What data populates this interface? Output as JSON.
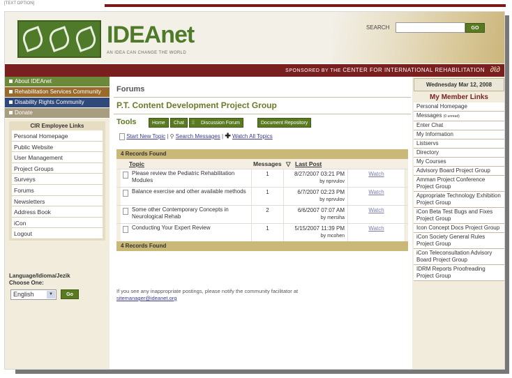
{
  "text_option": "[TEXT OPTION]",
  "header": {
    "logo_text": "IDEAnet",
    "tagline": "AN IDEA CAN CHANGE THE WORLD",
    "search_label": "SEARCH",
    "search_value": "",
    "search_go": "GO"
  },
  "sponsor": {
    "prefix": "SPONSORED BY THE ",
    "link": "CENTER FOR INTERNATIONAL REHABILITATION"
  },
  "leftnav": {
    "items": [
      {
        "label": "About IDEAnet"
      },
      {
        "label": "Rehabilitation Services Community"
      },
      {
        "label": "Disability Rights Community"
      },
      {
        "label": "Donate"
      }
    ],
    "cir_title": "CIR Employee Links",
    "cir_links": [
      "Personal Homepage",
      "Public Website",
      "User Management",
      "Project Groups",
      "Surveys",
      "Forums",
      "Newsletters",
      "Address Book",
      "iCon",
      "Logout"
    ],
    "language_label": "Language/Idioma/Jezik",
    "choose_one": "Choose One:",
    "language_value": "English",
    "language_go": "Go"
  },
  "main": {
    "heading": "Forums",
    "group_title": "P.T. Content Development Project Group",
    "tools_label": "Tools",
    "tools": [
      "Home",
      "Chat",
      "Discussion Forum",
      "Document Repository"
    ],
    "actions": {
      "start_new_topic": "Start New Topic",
      "search_messages": "Search Messages",
      "watch_all": "Watch All Topics"
    },
    "records_header": "4 Records Found",
    "records_footer": "4 Records Found",
    "columns": {
      "topic": "Topic",
      "messages": "Messages",
      "last_post": "Last Post"
    },
    "rows": [
      {
        "topic": "Please review the Pediatric Rehabilitation Modules",
        "messages": "1",
        "date": "8/27/2007 03:21 PM",
        "by": "by nprvulov",
        "watch": "Watch"
      },
      {
        "topic": "Balance exercise and other available methods",
        "messages": "1",
        "date": "6/7/2007 02:23 PM",
        "by": "by nprvulov",
        "watch": "Watch"
      },
      {
        "topic": "Some other Contemporary Concepts in Neurological Rehab",
        "messages": "2",
        "date": "6/6/2007 07:07 AM",
        "by": "by mersiha",
        "watch": "Watch"
      },
      {
        "topic": "Conducting Your Expert Review",
        "messages": "1",
        "date": "5/15/2007 11:39 PM",
        "by": "by mcohen",
        "watch": "Watch"
      }
    ],
    "notice_text": "If you see any inappropriate postings, please notify the community facilitator at",
    "notice_email": "sitemanager@ideanet.org"
  },
  "right": {
    "date": "Wednesday Mar 12, 2008",
    "member_title": "My Member Links",
    "links": [
      {
        "label": "Personal Homepage"
      },
      {
        "label": "Messages",
        "extra": "(0 unread)"
      },
      {
        "label": "Enter Chat"
      },
      {
        "label": "My Information"
      },
      {
        "label": "Listservs"
      },
      {
        "label": "Directory"
      },
      {
        "label": "My Courses"
      },
      {
        "label": "Advisory Board Project Group"
      },
      {
        "label": "Amman Project Conference Project Group"
      },
      {
        "label": "Appropriate Technology Exhibition Project Group"
      },
      {
        "label": "iCon Beta Test Bugs and Fixes Project Group"
      },
      {
        "label": "Icon Concept Docs Project Group"
      },
      {
        "label": "iCon Society General Rules Project Group"
      },
      {
        "label": "iCon Teleconsultation Advisory Board Project Group"
      },
      {
        "label": "IDRM Reports Proofreading Project Group"
      }
    ]
  },
  "colors": {
    "brand_green": "#4f7a2a",
    "maroon": "#7a1f1f",
    "tan_header": "#c9b877"
  }
}
